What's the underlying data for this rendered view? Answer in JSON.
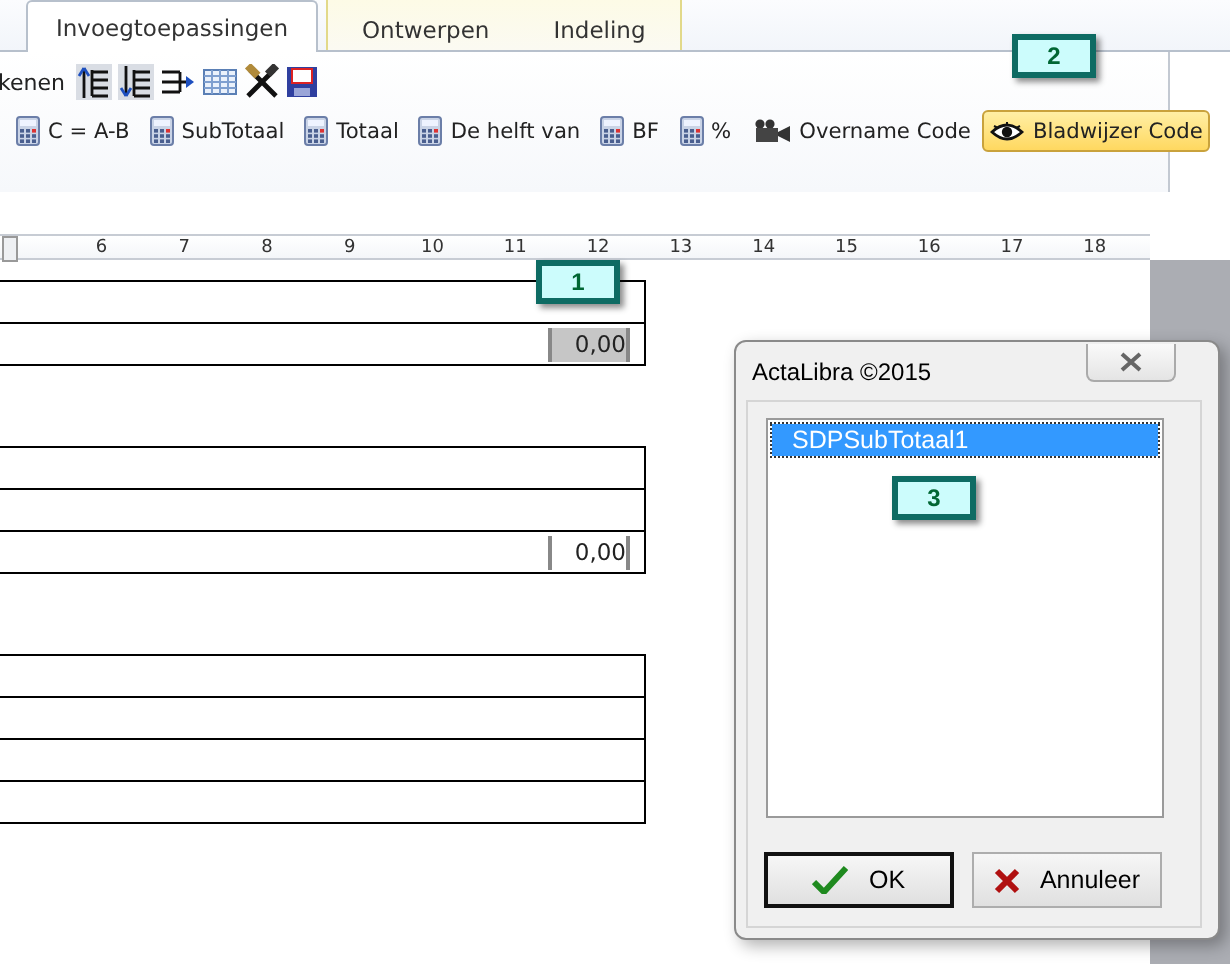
{
  "ribbon": {
    "tabs": [
      {
        "label": "Invoegtoepassingen",
        "selected": true
      },
      {
        "label": "Ontwerpen",
        "selected": false
      },
      {
        "label": "Indeling",
        "selected": false
      }
    ],
    "group_label": "kenen",
    "buttons": [
      {
        "label": "C = A-B",
        "kind": "calculator",
        "selected": false
      },
      {
        "label": "SubTotaal",
        "kind": "calculator",
        "selected": false
      },
      {
        "label": "Totaal",
        "kind": "calculator",
        "selected": false
      },
      {
        "label": "De helft van",
        "kind": "calculator",
        "selected": false
      },
      {
        "label": "BF",
        "kind": "calculator",
        "selected": false
      },
      {
        "label": "%",
        "kind": "calculator",
        "selected": false
      },
      {
        "label": "Overname Code",
        "kind": "projector",
        "selected": false
      },
      {
        "label": "Bladwijzer Code",
        "kind": "eye",
        "selected": true
      }
    ]
  },
  "ruler": {
    "labels": [
      "6",
      "7",
      "8",
      "9",
      "10",
      "11",
      "12",
      "13",
      "14",
      "15",
      "16",
      "17",
      "18"
    ]
  },
  "document": {
    "tables": [
      {
        "rows": [
          {
            "kind": "empty"
          },
          {
            "kind": "field",
            "value": "0,00",
            "selected": true
          }
        ]
      },
      {
        "rows": [
          {
            "kind": "empty"
          },
          {
            "kind": "empty"
          },
          {
            "kind": "field",
            "value": "0,00",
            "selected": false
          }
        ]
      },
      {
        "rows": [
          {
            "kind": "empty"
          },
          {
            "kind": "empty"
          },
          {
            "kind": "empty"
          },
          {
            "kind": "empty"
          }
        ]
      }
    ]
  },
  "dialog": {
    "title": "ActaLibra ©2015",
    "items": [
      {
        "label": "SDPSubTotaal1",
        "selected": true
      }
    ],
    "buttons": [
      {
        "label": "OK",
        "kind": "ok"
      },
      {
        "label": "Annuleer",
        "kind": "cancel"
      }
    ]
  },
  "callouts": [
    {
      "label": "1"
    },
    {
      "label": "2"
    },
    {
      "label": "3"
    }
  ]
}
